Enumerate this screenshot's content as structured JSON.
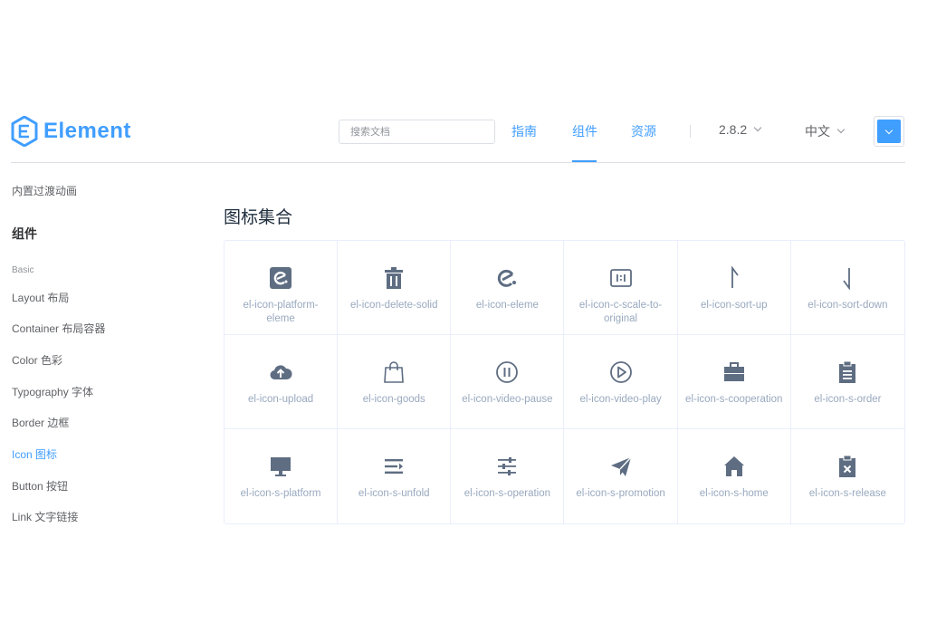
{
  "header": {
    "logo_text": "Element",
    "search_placeholder": "搜索文档",
    "nav": [
      "指南",
      "组件",
      "资源"
    ],
    "active_nav": "组件",
    "version": "2.8.2",
    "language": "中文",
    "accent_color": "#409eff"
  },
  "sidebar": {
    "top_item": "内置过渡动画",
    "group_title": "组件",
    "subgroup": "Basic",
    "items": [
      "Layout 布局",
      "Container 布局容器",
      "Color 色彩",
      "Typography 字体",
      "Border 边框",
      "Icon 图标",
      "Button 按钮",
      "Link 文字链接"
    ],
    "active_item": "Icon 图标"
  },
  "main": {
    "title": "图标集合",
    "icons": [
      {
        "name": "el-icon-platform-eleme",
        "icon": "platform-eleme-icon"
      },
      {
        "name": "el-icon-delete-solid",
        "icon": "delete-solid-icon"
      },
      {
        "name": "el-icon-eleme",
        "icon": "eleme-icon"
      },
      {
        "name": "el-icon-c-scale-to-original",
        "icon": "scale-to-original-icon"
      },
      {
        "name": "el-icon-sort-up",
        "icon": "sort-up-icon"
      },
      {
        "name": "el-icon-sort-down",
        "icon": "sort-down-icon"
      },
      {
        "name": "el-icon-upload",
        "icon": "upload-icon"
      },
      {
        "name": "el-icon-goods",
        "icon": "goods-icon"
      },
      {
        "name": "el-icon-video-pause",
        "icon": "video-pause-icon"
      },
      {
        "name": "el-icon-video-play",
        "icon": "video-play-icon"
      },
      {
        "name": "el-icon-s-cooperation",
        "icon": "cooperation-icon"
      },
      {
        "name": "el-icon-s-order",
        "icon": "order-icon"
      },
      {
        "name": "el-icon-s-platform",
        "icon": "platform-icon"
      },
      {
        "name": "el-icon-s-unfold",
        "icon": "unfold-icon"
      },
      {
        "name": "el-icon-s-operation",
        "icon": "operation-icon"
      },
      {
        "name": "el-icon-s-promotion",
        "icon": "promotion-icon"
      },
      {
        "name": "el-icon-s-home",
        "icon": "home-icon"
      },
      {
        "name": "el-icon-s-release",
        "icon": "release-icon"
      }
    ]
  }
}
